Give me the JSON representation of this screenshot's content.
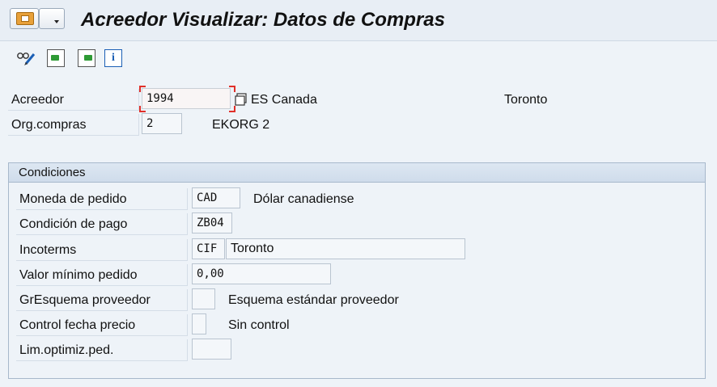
{
  "window": {
    "title": "Acreedor Visualizar: Datos de Compras"
  },
  "toolbar": {
    "icons": [
      "display-change-icon",
      "previous-screen-icon",
      "next-screen-icon",
      "info-icon"
    ],
    "info_glyph": "i"
  },
  "header": {
    "vendor_label": "Acreedor",
    "vendor_value": "1994",
    "vendor_name": "ES Canada",
    "vendor_city": "Toronto",
    "porg_label": "Org.compras",
    "porg_value": "2",
    "porg_text": "EKORG 2"
  },
  "conditions": {
    "title": "Condiciones",
    "currency_label": "Moneda de pedido",
    "currency_value": "CAD",
    "currency_text": "Dólar canadiense",
    "payterm_label": "Condición de pago",
    "payterm_value": "ZB04",
    "incoterms_label": "Incoterms",
    "incoterms_value1": "CIF",
    "incoterms_value2": "Toronto",
    "minval_label": "Valor mínimo pedido",
    "minval_value": "0,00",
    "schema_label": "GrEsquema proveedor",
    "schema_value": "",
    "schema_text": "Esquema estándar proveedor",
    "pricectl_label": "Control fecha precio",
    "pricectl_value": "",
    "pricectl_text": "Sin control",
    "optlim_label": "Lim.optimiz.ped.",
    "optlim_value": ""
  },
  "colors": {
    "background": "#eef3f8",
    "focus_corner": "#e0302a",
    "group_border": "#a7b8cb"
  }
}
